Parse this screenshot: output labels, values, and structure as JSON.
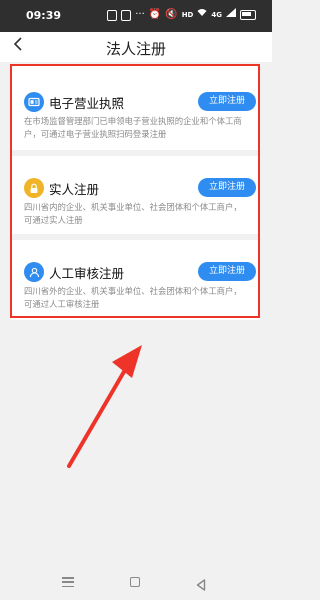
{
  "status_bar": {
    "time": "09:39",
    "icons": [
      "notification-icon",
      "notification-icon",
      "more-icon",
      "alarm-icon",
      "volume-icon",
      "hd-icon",
      "wifi-icon",
      "signal-icon",
      "battery-icon"
    ],
    "hd_label": "HD",
    "signal_label": "4G"
  },
  "header": {
    "title": "法人注册",
    "back_icon": "chevron-left-icon"
  },
  "cards": [
    {
      "icon": "license-card-icon",
      "icon_color": "#2f8cf0",
      "title": "电子营业执照",
      "button": "立即注册",
      "desc": "在市场监督管理部门已申领电子营业执照的企业和个体工商户，可通过电子营业执照扫码登录注册"
    },
    {
      "icon": "lock-icon",
      "icon_color": "#f0b429",
      "title": "实人注册",
      "button": "立即注册",
      "desc": "四川省内的企业、机关事业单位、社会团体和个体工商户，可通过实人注册"
    },
    {
      "icon": "person-icon",
      "icon_color": "#2f8cf0",
      "title": "人工审核注册",
      "button": "立即注册",
      "desc": "四川省外的企业、机关事业单位、社会团体和个体工商户，可通过人工审核注册"
    }
  ],
  "annotation": {
    "highlight_color": "#ee3328",
    "arrow_icon": "arrow-annotation"
  },
  "nav_bar": {
    "icons": [
      "menu-icon",
      "home-icon",
      "back-triangle-icon"
    ]
  }
}
